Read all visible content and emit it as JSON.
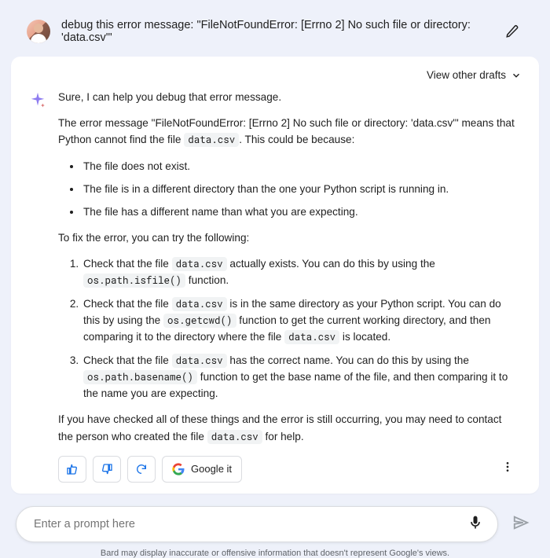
{
  "prompt": {
    "text": "debug this error message: \"FileNotFoundError: [Errno 2] No such file or directory: 'data.csv'\""
  },
  "drafts": {
    "label": "View other drafts"
  },
  "response": {
    "intro": "Sure, I can help you debug that error message.",
    "para1_pre": "The error message \"FileNotFoundError: [Errno 2] No such file or directory: 'data.csv'\" means that Python cannot find the file ",
    "para1_code": "data.csv",
    "para1_post": ". This could be because:",
    "causes": [
      "The file does not exist.",
      "The file is in a different directory than the one your Python script is running in.",
      "The file has a different name than what you are expecting."
    ],
    "fix_intro": "To fix the error, you can try the following:",
    "fix1_a": "Check that the file ",
    "fix1_code1": "data.csv",
    "fix1_b": " actually exists. You can do this by using the ",
    "fix1_code2": "os.path.isfile()",
    "fix1_c": " function.",
    "fix2_a": "Check that the file ",
    "fix2_code1": "data.csv",
    "fix2_b": " is in the same directory as your Python script. You can do this by using the ",
    "fix2_code2": "os.getcwd()",
    "fix2_c": " function to get the current working directory, and then comparing it to the directory where the file ",
    "fix2_code3": "data.csv",
    "fix2_d": " is located.",
    "fix3_a": "Check that the file ",
    "fix3_code1": "data.csv",
    "fix3_b": " has the correct name. You can do this by using the ",
    "fix3_code2": "os.path.basename()",
    "fix3_c": " function to get the base name of the file, and then comparing it to the name you are expecting.",
    "closing_a": "If you have checked all of these things and the error is still occurring, you may need to contact the person who created the file ",
    "closing_code": "data.csv",
    "closing_b": " for help."
  },
  "feedback": {
    "google_it": "Google it"
  },
  "input": {
    "placeholder": "Enter a prompt here"
  },
  "disclaimer": "Bard may display inaccurate or offensive information that doesn't represent Google's views."
}
